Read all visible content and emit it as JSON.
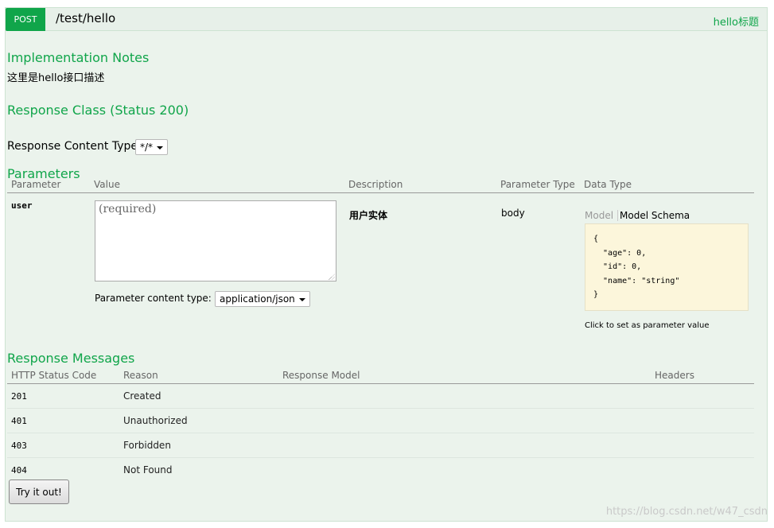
{
  "operation": {
    "verb": "POST",
    "path": "/test/hello",
    "summary": "hello标题"
  },
  "implementation": {
    "heading": "Implementation Notes",
    "notes": "这里是hello接口描述"
  },
  "response_class": {
    "heading": "Response Class (Status 200)"
  },
  "response_content_type": {
    "label": "Response Content Type",
    "selected": "*/*"
  },
  "parameters": {
    "heading": "Parameters",
    "columns": [
      "Parameter",
      "Value",
      "Description",
      "Parameter Type",
      "Data Type"
    ],
    "rows": [
      {
        "name": "user",
        "placeholder": "(required)",
        "description": "用户实体",
        "param_type": "body"
      }
    ],
    "content_type_label": "Parameter content type:",
    "content_type_selected": "application/json"
  },
  "data_type": {
    "tab_model": "Model",
    "tab_schema": "Model Schema",
    "schema": "{\n  \"age\": 0,\n  \"id\": 0,\n  \"name\": \"string\"\n}",
    "hint": "Click to set as parameter value"
  },
  "response_messages": {
    "heading": "Response Messages",
    "columns": [
      "HTTP Status Code",
      "Reason",
      "Response Model",
      "Headers"
    ],
    "rows": [
      {
        "code": "201",
        "reason": "Created"
      },
      {
        "code": "401",
        "reason": "Unauthorized"
      },
      {
        "code": "403",
        "reason": "Forbidden"
      },
      {
        "code": "404",
        "reason": "Not Found"
      }
    ]
  },
  "try_button": "Try it out!",
  "watermark": "https://blog.csdn.net/w47_csdn",
  "colors": {
    "accent": "#10a54a",
    "panel_bg": "#ebf3ec",
    "schema_bg": "#fcf6db"
  }
}
